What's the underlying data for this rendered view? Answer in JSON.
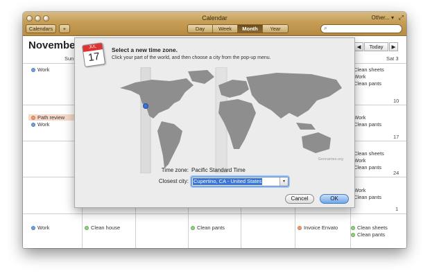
{
  "app": {
    "window_title": "Calendar",
    "other_menu": "Other... ▾",
    "toolbar": {
      "calendars_label": "Calendars",
      "add_label": "+",
      "views": [
        {
          "label": "Day",
          "active": false
        },
        {
          "label": "Week",
          "active": false
        },
        {
          "label": "Month",
          "active": true
        },
        {
          "label": "Year",
          "active": false
        }
      ],
      "search_placeholder": ""
    }
  },
  "calendar": {
    "month_title": "November",
    "prev_label": "◀",
    "today_label": "Today",
    "next_label": "▶",
    "day_names": [
      "Sun",
      "Sat 3"
    ],
    "day_numbers": [
      "10",
      "17",
      "24",
      "1"
    ],
    "events": [
      {
        "text": "Work",
        "color": "blue",
        "col": "sun",
        "row": 0
      },
      {
        "text": "Path review",
        "color": "orange",
        "col": "sun",
        "row": 1
      },
      {
        "text": "Work",
        "color": "blue",
        "col": "sun",
        "row": 1
      },
      {
        "text": "Work",
        "color": "blue",
        "col": "sun",
        "row": 4
      },
      {
        "text": "Clean house",
        "color": "green",
        "col": "mon",
        "row": 4
      },
      {
        "text": "Clean pants",
        "color": "green",
        "col": "wed",
        "row": 4
      },
      {
        "text": "Invoice Envato",
        "color": "orange",
        "col": "fri",
        "row": 4
      },
      {
        "text": "Clean sheets",
        "color": "green",
        "col": "sat",
        "row": 0
      },
      {
        "text": "Work",
        "color": "blue",
        "col": "sat",
        "row": 0
      },
      {
        "text": "Clean pants",
        "color": "green",
        "col": "sat",
        "row": 0
      },
      {
        "text": "Work",
        "color": "blue",
        "col": "sat",
        "row": 1
      },
      {
        "text": "Clean pants",
        "color": "green",
        "col": "sat",
        "row": 1
      },
      {
        "text": "Clean sheets",
        "color": "green",
        "col": "sat",
        "row": 2
      },
      {
        "text": "Work",
        "color": "blue",
        "col": "sat",
        "row": 2
      },
      {
        "text": "Clean pants",
        "color": "green",
        "col": "sat",
        "row": 2
      },
      {
        "text": "Work",
        "color": "blue",
        "col": "sat",
        "row": 3
      },
      {
        "text": "Clean pants",
        "color": "green",
        "col": "sat",
        "row": 3
      },
      {
        "text": "Clean sheets",
        "color": "green",
        "col": "sat",
        "row": 4
      },
      {
        "text": "Clean pants",
        "color": "green",
        "col": "sat",
        "row": 4
      }
    ]
  },
  "dialog": {
    "icon_number": "17",
    "icon_month": "JUL",
    "title": "Select a new time zone.",
    "subtitle": "Click your part of the world, and then choose a city from the pop-up menu.",
    "watermark": "Geonames.org",
    "timezone_label": "Time zone:",
    "timezone_value": "Pacific Standard Time",
    "city_label": "Closest city:",
    "city_value": "Cupertino, CA - United States",
    "cancel_label": "Cancel",
    "ok_label": "OK"
  },
  "colors": {
    "titlebar": "#c59d55",
    "selection": "#3875d7",
    "event_blue": "#6aa3e0",
    "event_green": "#8fd17b",
    "event_orange": "#f29a6a"
  }
}
